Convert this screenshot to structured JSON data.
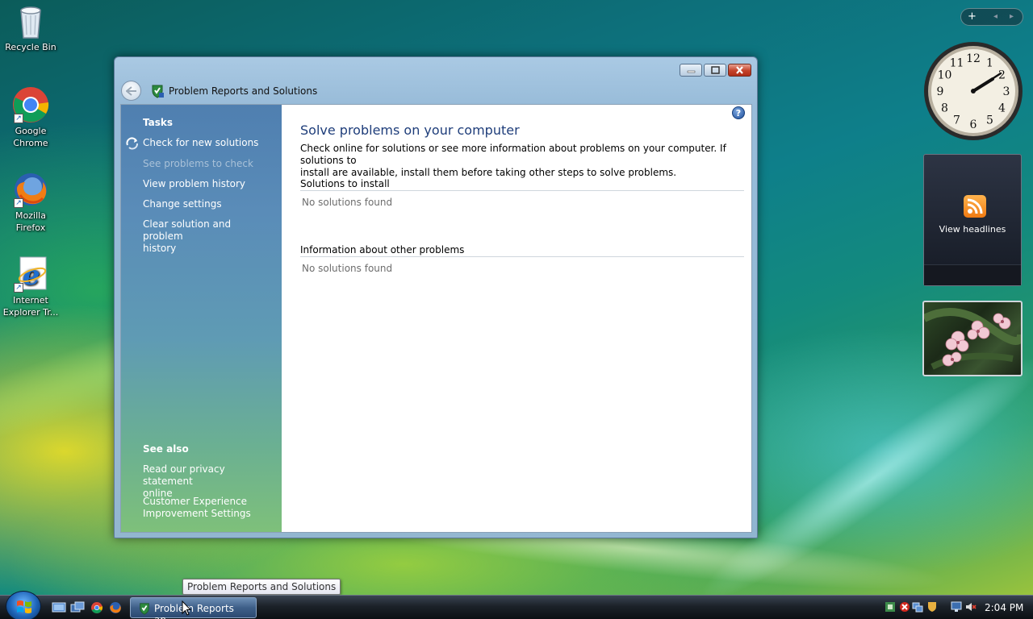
{
  "desktop": {
    "icons": [
      {
        "label_line1": "Recycle Bin",
        "label_line2": ""
      },
      {
        "label_line1": "Google",
        "label_line2": "Chrome"
      },
      {
        "label_line1": "Mozilla",
        "label_line2": "Firefox"
      },
      {
        "label_line1": "Internet",
        "label_line2": "Explorer Tr..."
      }
    ]
  },
  "gadgets": {
    "sidebar_controls": {
      "add": "+",
      "prev": "◂",
      "next": "▸"
    },
    "clock": {
      "numbers": [
        "12",
        "1",
        "2",
        "3",
        "4",
        "5",
        "6",
        "7",
        "8",
        "9",
        "10",
        "11"
      ]
    },
    "feed": {
      "label": "View headlines"
    }
  },
  "window": {
    "title": "Problem Reports and Solutions",
    "left_pane": {
      "tasks_heading": "Tasks",
      "tasks": [
        {
          "label": "Check for new solutions",
          "enabled": true
        },
        {
          "label": "See problems to check",
          "enabled": false
        },
        {
          "label": "View problem history",
          "enabled": true
        },
        {
          "label": "Change settings",
          "enabled": true
        },
        {
          "label_line1": "Clear solution and problem",
          "label_line2": "history",
          "enabled": true
        }
      ],
      "see_also_heading": "See also",
      "see_also": [
        {
          "label_line1": "Read our privacy statement",
          "label_line2": "online"
        },
        {
          "label_line1": "Customer Experience",
          "label_line2": "Improvement Settings"
        }
      ]
    },
    "main": {
      "help": "?",
      "title": "Solve problems on your computer",
      "description_line1": "Check online for solutions or see more information about problems on your computer. If solutions to",
      "description_line2": "install are available, install them before taking other steps to solve problems.",
      "sections": [
        {
          "heading": "Solutions to install",
          "empty_text": "No solutions found"
        },
        {
          "heading": "Information about other problems",
          "empty_text": "No solutions found"
        }
      ]
    }
  },
  "tooltip": "Problem Reports and Solutions",
  "taskbar": {
    "active_task_label": "Problem Reports an...",
    "clock": "2:04 PM"
  },
  "colors": {
    "accent": "#1e3d7a",
    "left_pane_top": "#4f7fb0",
    "left_pane_bottom": "#7ec07a",
    "close_button": "#c4422a"
  }
}
